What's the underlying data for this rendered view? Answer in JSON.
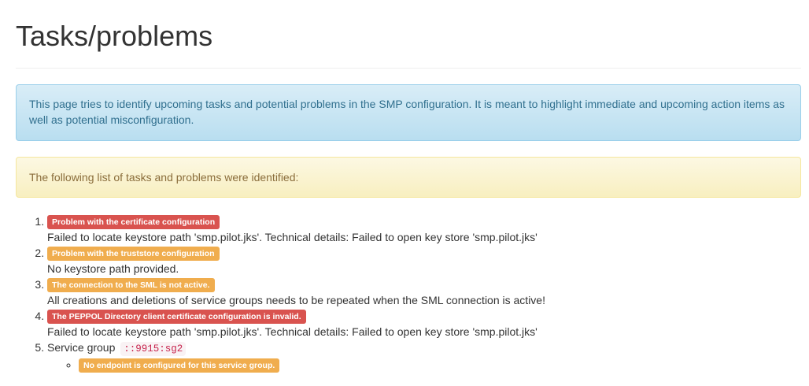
{
  "page": {
    "title": "Tasks/problems"
  },
  "info_alert": {
    "text": "This page tries to identify upcoming tasks and potential problems in the SMP configuration. It is meant to highlight immediate and upcoming action items as well as potential misconfiguration."
  },
  "warning_alert": {
    "text": "The following list of tasks and problems were identified:"
  },
  "tasks": [
    {
      "label": "Problem with the certificate configuration",
      "severity": "danger",
      "detail": "Failed to locate keystore path 'smp.pilot.jks'. Technical details: Failed to open key store 'smp.pilot.jks'"
    },
    {
      "label": "Problem with the truststore configuration",
      "severity": "warning",
      "detail": "No keystore path provided."
    },
    {
      "label": "The connection to the SML is not active.",
      "severity": "warning",
      "detail": "All creations and deletions of service groups needs to be repeated when the SML connection is active!"
    },
    {
      "label": "The PEPPOL Directory client certificate configuration is invalid.",
      "severity": "danger",
      "detail": "Failed to locate keystore path 'smp.pilot.jks'. Technical details: Failed to open key store 'smp.pilot.jks'"
    },
    {
      "text": "Service group",
      "code": "::9915:sg2",
      "sub_items": [
        {
          "label": "No endpoint is configured for this service group.",
          "severity": "warning"
        }
      ]
    }
  ],
  "colors": {
    "danger": "#d9534f",
    "warning": "#f0ad4e",
    "info_text": "#31708f",
    "warning_text": "#8a6d3b"
  }
}
